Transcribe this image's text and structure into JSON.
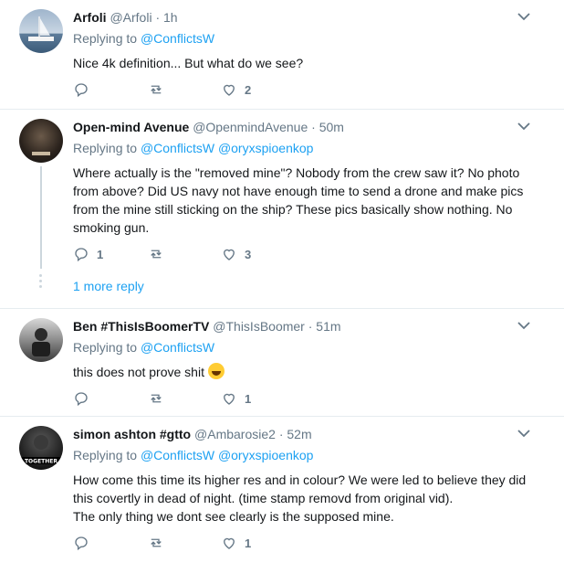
{
  "tweets": [
    {
      "name": "Arfoli",
      "handle": "@Arfoli",
      "time": "1h",
      "replying_label": "Replying to",
      "mentions": [
        "@ConflictsW"
      ],
      "text": "Nice 4k definition... But what do we see?",
      "replies": "",
      "retweets": "",
      "likes": "2"
    },
    {
      "name": "Open-mind Avenue",
      "handle": "@OpenmindAvenue",
      "time": "50m",
      "replying_label": "Replying to",
      "mentions": [
        "@ConflictsW",
        "@oryxspioenkop"
      ],
      "text": "Where actually is the \"removed mine\"? Nobody from the crew saw it? No photo from above? Did US navy not have enough time to send a drone and make pics from the mine still sticking on the ship? These pics basically show nothing. No smoking gun.",
      "replies": "1",
      "retweets": "",
      "likes": "3",
      "more_replies": "1 more reply"
    },
    {
      "name": "Ben #ThisIsBoomerTV",
      "handle": "@ThisIsBoomer",
      "time": "51m",
      "replying_label": "Replying to",
      "mentions": [
        "@ConflictsW"
      ],
      "text": "this does not prove shit",
      "replies": "",
      "retweets": "",
      "likes": "1"
    },
    {
      "name": "simon ashton #gtto",
      "handle": "@Ambarosie2",
      "time": "52m",
      "replying_label": "Replying to",
      "mentions": [
        "@ConflictsW",
        "@oryxspioenkop"
      ],
      "text_lines": [
        "How come this time its higher res and in colour?  We were led to believe they did this covertly in dead of night.  (time stamp removd from original vid).",
        "The only thing we dont see clearly is the supposed mine."
      ],
      "replies": "",
      "retweets": "",
      "likes": "1",
      "avatar_text": "TOGETHER"
    }
  ],
  "separator": "·",
  "colors": {
    "link": "#1da1f2",
    "muted": "#657786",
    "text": "#14171a",
    "border": "#e6ecf0"
  },
  "icons": [
    "reply-icon",
    "retweet-icon",
    "like-icon",
    "caret-down-icon",
    "laughing-emoji-icon"
  ]
}
